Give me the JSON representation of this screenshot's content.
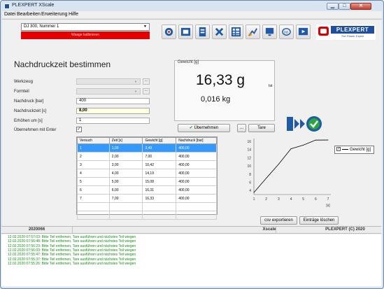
{
  "window": {
    "title": "PLEXPERT XScale",
    "buttons": {
      "minimize": "▁",
      "maximize": "□",
      "close": "✕"
    }
  },
  "menu": [
    "Datei",
    "Bearbeiten",
    "Erweiterung",
    "Hilfe"
  ],
  "machine": {
    "value": "DJ 300, Nummer 1"
  },
  "status_bar_red": "Waage kalibrieren",
  "toolbar": [
    "tool1-icon",
    "tool2-icon",
    "tool3-icon",
    "tool4-icon",
    "grid-icon",
    "chart-icon",
    "monitor-icon",
    "db-icon",
    "play-icon",
    "pen-icon"
  ],
  "logo": {
    "text": "PLEXPERT",
    "tagline": "The Plastic Expert",
    "color": "#1f4e9e",
    "accent": "#d80000"
  },
  "page": {
    "title": "Nachdruckzeit bestimmen"
  },
  "form": {
    "werkzeug": {
      "label": "Werkzeug",
      "value": ""
    },
    "formteil": {
      "label": "Formteil",
      "value": ""
    },
    "nachdruck": {
      "label": "Nachdruck [bar]",
      "value": "400"
    },
    "nachdruckzeit": {
      "label": "Nachdruckzeit [s]",
      "value": "8,00"
    },
    "erhoehen": {
      "label": "Erhöhen um [s]",
      "value": "1"
    },
    "uebernehmen_enter": {
      "label": "Übernehmen mit Enter",
      "checked": "✓"
    },
    "ellipsis": "..."
  },
  "weight": {
    "label": "Gewicht [g]",
    "value": "16,33 g",
    "ist": "Ist",
    "kg": "0,016 kg"
  },
  "buttons": {
    "uebernehmen": "Übernehmen",
    "dots": "...",
    "tare": "Tare",
    "csv": "csv exportieren",
    "delete": "Einträge löschen"
  },
  "table": {
    "headers": [
      "Versuch",
      "Zeit [s]",
      "Gewicht [g]",
      "Nachdruck [bar]"
    ],
    "rows": [
      [
        "1",
        "1,00",
        "3,49",
        "400,00"
      ],
      [
        "2",
        "2,00",
        "7,00",
        "400,00"
      ],
      [
        "3",
        "3,00",
        "10,42",
        "400,00"
      ],
      [
        "4",
        "4,00",
        "14,19",
        "400,00"
      ],
      [
        "5",
        "5,00",
        "15,08",
        "400,00"
      ],
      [
        "6",
        "6,00",
        "16,31",
        "400,00"
      ],
      [
        "7",
        "7,00",
        "16,33",
        "400,00"
      ]
    ],
    "selected": 0
  },
  "chart_data": {
    "type": "line",
    "x": [
      1,
      2,
      3,
      4,
      5,
      6,
      7
    ],
    "series": [
      {
        "name": "Gewicht [g]",
        "values": [
          3.49,
          7.0,
          10.42,
          14.19,
          15.08,
          16.31,
          16.33
        ]
      }
    ],
    "xlabel": "[s]",
    "ylabel": "",
    "xlim": [
      1,
      7
    ],
    "ylim": [
      3,
      16
    ],
    "xticks": [
      "1",
      "2",
      "3",
      "4",
      "5",
      "6",
      "7"
    ],
    "yticks": [
      "4",
      "6",
      "8",
      "10",
      "12",
      "14",
      "16"
    ],
    "legend": "top-right",
    "grid": false,
    "line_color": "#000000"
  },
  "statusbar": {
    "left": "2020066",
    "middle": "Xscale",
    "right": "PLEXPERT (C) 2020"
  },
  "log": [
    "12.02.2020 07:57:03: Bitte Teil entfernen, Tare ausführen und nächstes Teil wiegen",
    "12.02.2020 07:56:48: Bitte Teil entfernen, Tare ausführen und nächstes Teil wiegen",
    "12.02.2020 07:56:23: Bitte Teil entfernen, Tare ausführen und nächstes Teil wiegen",
    "12.02.2020 07:56:03: Bitte Teil entfernen, Tare ausführen und nächstes Teil wiegen",
    "12.02.2020 07:55:47: Bitte Teil entfernen, Tare ausführen und nächstes Teil wiegen",
    "12.02.2020 07:55:37: Bitte Teil entfernen, Tare ausführen und nächstes Teil wiegen",
    "12.02.2020 07:55:26: Bitte Teil entfernen, Tare ausführen und nächstes Teil wiegen"
  ]
}
